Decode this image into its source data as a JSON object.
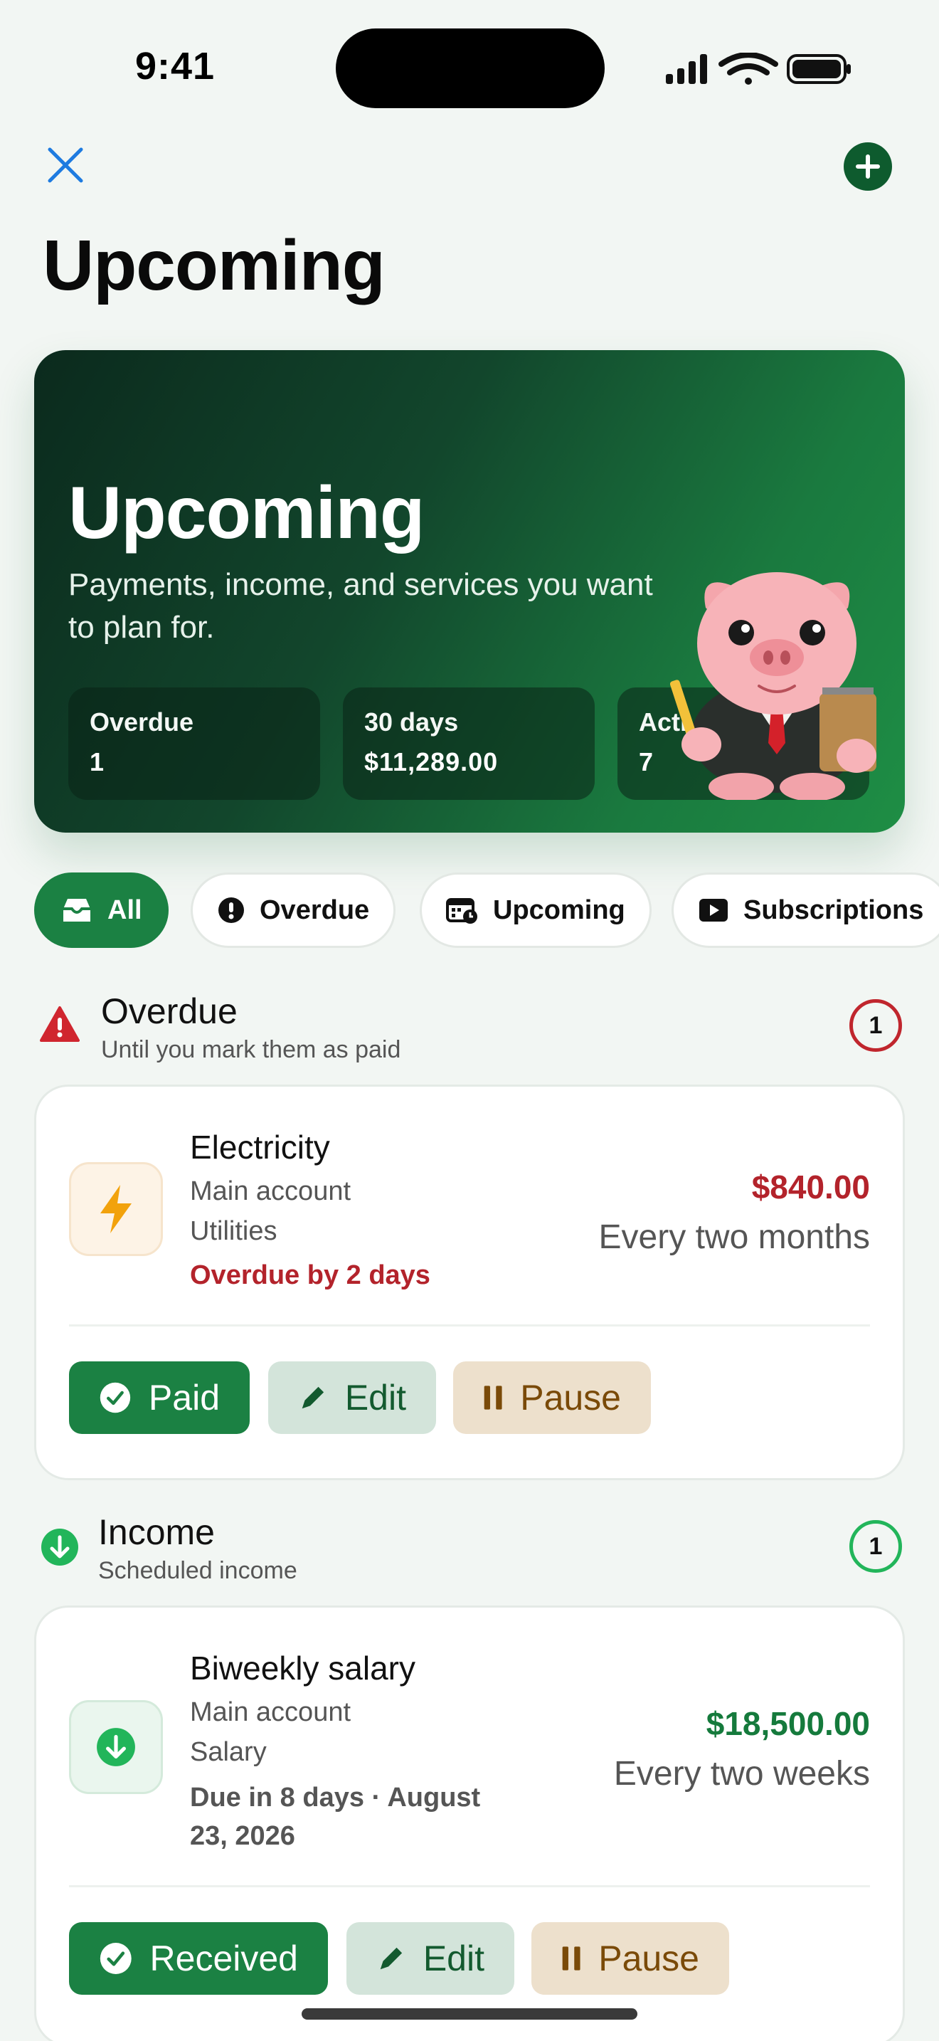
{
  "status_bar": {
    "time": "9:41"
  },
  "nav": {
    "close_icon": "close-icon",
    "add_icon": "plus-icon",
    "title": "Upcoming"
  },
  "hero": {
    "title": "Upcoming",
    "subtitle": "Payments, income, and services you want to plan for.",
    "stats": [
      {
        "label": "Overdue",
        "value": "1"
      },
      {
        "label": "30 days",
        "value": "$11,289.00"
      },
      {
        "label": "Active",
        "value": "7"
      }
    ]
  },
  "filters": [
    {
      "label": "All",
      "icon": "tray-icon",
      "active": true
    },
    {
      "label": "Overdue",
      "icon": "exclamation-circle-icon",
      "active": false
    },
    {
      "label": "Upcoming",
      "icon": "calendar-clock-icon",
      "active": false
    },
    {
      "label": "Subscriptions",
      "icon": "play-rectangle-icon",
      "active": false
    }
  ],
  "sections": [
    {
      "title": "Overdue",
      "subtitle": "Until you mark them as paid",
      "count": "1",
      "icon": "warning-triangle-icon",
      "items": [
        {
          "name": "Electricity",
          "account": "Main account",
          "category": "Utilities",
          "status": "Overdue by 2 days",
          "amount": "$840.00",
          "frequency": "Every two months",
          "icon": "bolt-icon",
          "actions": {
            "primary": "Paid",
            "edit": "Edit",
            "pause": "Pause"
          }
        }
      ]
    },
    {
      "title": "Income",
      "subtitle": "Scheduled income",
      "count": "1",
      "icon": "arrow-down-circle-icon",
      "items": [
        {
          "name": "Biweekly salary",
          "account": "Main account",
          "category": "Salary",
          "status_line1": "Due in 8 days · August",
          "status_line2": "23, 2026",
          "amount": "$18,500.00",
          "frequency": "Every two weeks",
          "icon": "arrow-down-circle-icon",
          "actions": {
            "primary": "Received",
            "edit": "Edit",
            "pause": "Pause"
          }
        }
      ]
    }
  ],
  "colors": {
    "brand_green": "#1B8143",
    "dark_green": "#0E5B2E",
    "overdue_red": "#B3232B",
    "income_green": "#157A3C",
    "pause_brown": "#7A4A08",
    "warning_orange": "#F2A20C"
  }
}
